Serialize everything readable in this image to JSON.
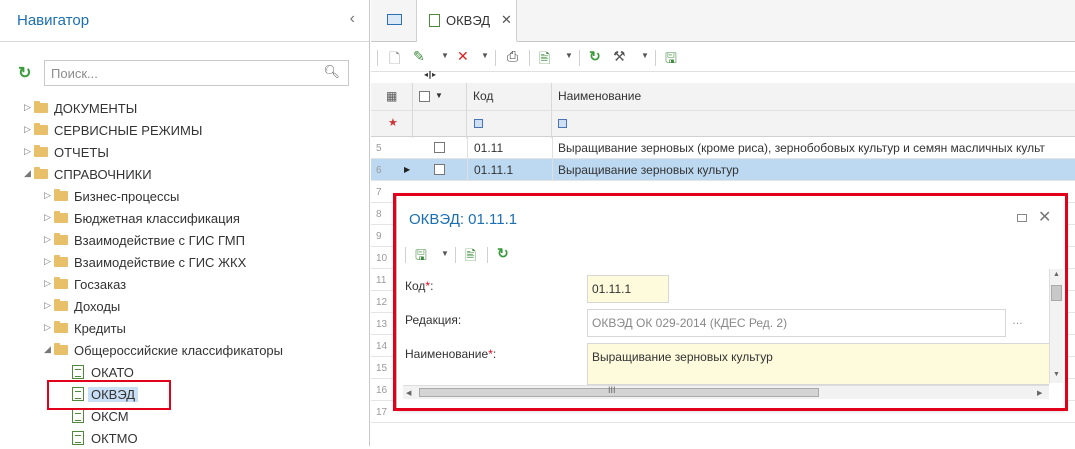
{
  "navigator": {
    "title": "Навигатор",
    "search_placeholder": "Поиск...",
    "items": [
      {
        "label": "ДОКУМЕНТЫ",
        "level": 0,
        "type": "folder",
        "expanded": false
      },
      {
        "label": "СЕРВИСНЫЕ РЕЖИМЫ",
        "level": 0,
        "type": "folder",
        "expanded": false
      },
      {
        "label": "ОТЧЕТЫ",
        "level": 0,
        "type": "folder",
        "expanded": false
      },
      {
        "label": "СПРАВОЧНИКИ",
        "level": 0,
        "type": "folder",
        "expanded": true
      },
      {
        "label": "Бизнес-процессы",
        "level": 1,
        "type": "folder",
        "expanded": false
      },
      {
        "label": "Бюджетная классификация",
        "level": 1,
        "type": "folder",
        "expanded": false
      },
      {
        "label": "Взаимодействие с ГИС ГМП",
        "level": 1,
        "type": "folder",
        "expanded": false
      },
      {
        "label": "Взаимодействие с ГИС ЖКХ",
        "level": 1,
        "type": "folder",
        "expanded": false
      },
      {
        "label": "Госзаказ",
        "level": 1,
        "type": "folder",
        "expanded": false
      },
      {
        "label": "Доходы",
        "level": 1,
        "type": "folder",
        "expanded": false
      },
      {
        "label": "Кредиты",
        "level": 1,
        "type": "folder",
        "expanded": false
      },
      {
        "label": "Общероссийские классификаторы",
        "level": 1,
        "type": "folder",
        "expanded": true
      },
      {
        "label": "ОКАТО",
        "level": 2,
        "type": "doc"
      },
      {
        "label": "ОКВЭД",
        "level": 2,
        "type": "doc",
        "selected": true
      },
      {
        "label": "ОКСМ",
        "level": 2,
        "type": "doc"
      },
      {
        "label": "ОКТМО",
        "level": 2,
        "type": "doc"
      }
    ]
  },
  "tabs": [
    {
      "label": "ОКВЭД"
    }
  ],
  "grid": {
    "columns": {
      "code": "Код",
      "name": "Наименование"
    },
    "rows": [
      {
        "num": "5",
        "code": "01.11",
        "name": "Выращивание зерновых (кроме риса), зернобобовых культур и семян масличных культ"
      },
      {
        "num": "6",
        "code": "01.11.1",
        "name": "Выращивание зерновых культур",
        "selected": true
      },
      {
        "num": "7",
        "code": "",
        "name": ""
      },
      {
        "num": "8",
        "code": "",
        "name": ""
      },
      {
        "num": "9",
        "code": "",
        "name": ""
      },
      {
        "num": "10",
        "code": "",
        "name": ""
      },
      {
        "num": "11",
        "code": "",
        "name": ""
      },
      {
        "num": "12",
        "code": "",
        "name": ""
      },
      {
        "num": "13",
        "code": "",
        "name": ""
      },
      {
        "num": "14",
        "code": "",
        "name": ""
      },
      {
        "num": "15",
        "code": "",
        "name": ""
      },
      {
        "num": "16",
        "code": "",
        "name": ""
      },
      {
        "num": "17",
        "code": "",
        "name": ""
      }
    ]
  },
  "dialog": {
    "title": "ОКВЭД: 01.11.1",
    "fields": {
      "code_label": "Код",
      "code_value": "01.11.1",
      "edition_label": "Редакция:",
      "edition_value": "ОКВЭД ОК 029-2014 (КДЕС Ред. 2)",
      "name_label": "Наименование",
      "name_value": "Выращивание зерновых культур"
    },
    "scroll_label": "III"
  },
  "colors": {
    "accent": "#1b6fb3",
    "highlight_red": "#e2001a",
    "required_field_bg": "#fdfbdb",
    "selected_row": "#bcd9f1"
  }
}
